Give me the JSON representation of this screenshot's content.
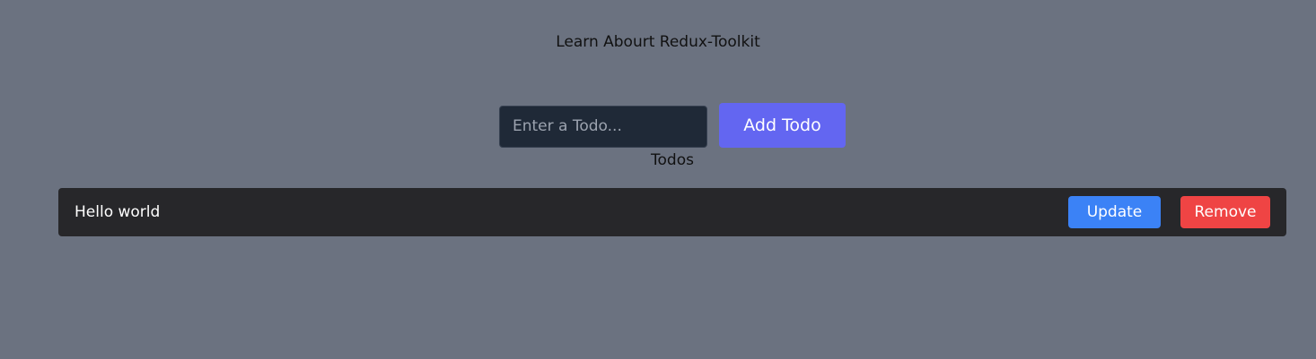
{
  "header": {
    "title": "Learn Abourt Redux-Toolkit"
  },
  "form": {
    "input_value": "",
    "input_placeholder": "Enter a Todo...",
    "add_label": "Add Todo"
  },
  "todos": {
    "heading": "Todos",
    "items": [
      {
        "text": "Hello world",
        "update_label": "Update",
        "remove_label": "Remove"
      }
    ]
  },
  "colors": {
    "page_background": "#6b7280",
    "input_background": "#1f2937",
    "add_button": "#6366f1",
    "todo_item_background": "#27272a",
    "update_button": "#3b82f6",
    "remove_button": "#ef4444"
  }
}
